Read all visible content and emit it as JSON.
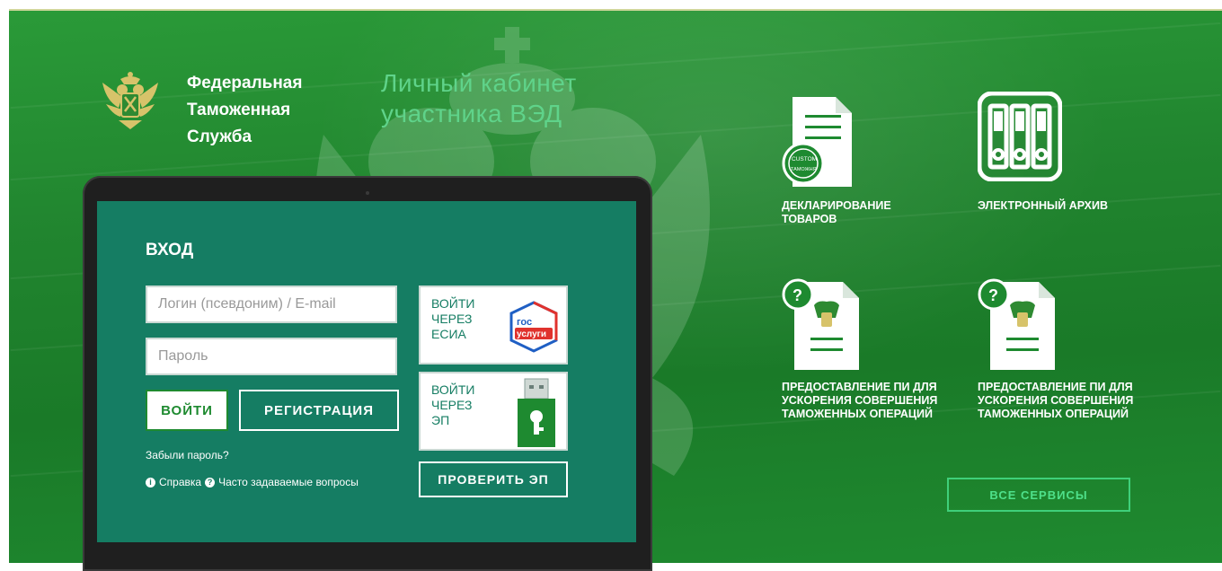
{
  "header": {
    "org_line1": "Федеральная",
    "org_line2": "Таможенная",
    "org_line3": "Служба",
    "app_line1": "Личный кабинет",
    "app_line2": "участника ВЭД"
  },
  "login": {
    "heading": "ВХОД",
    "login_placeholder": "Логин (псевдоним) / E-mail",
    "password_placeholder": "Пароль",
    "login_button": "ВОЙТИ",
    "register_button": "РЕГИСТРАЦИЯ",
    "forgot_password": "Забыли пароль?",
    "help_link": "Справка",
    "faq_link": "Часто задаваемые вопросы"
  },
  "alt_login": {
    "esia_line1": "ВОЙТИ",
    "esia_line2": "ЧЕРЕЗ",
    "esia_line3": "ЕСИА",
    "gosuslugi_top": "гос",
    "gosuslugi_bottom": "услуги",
    "ep_line1": "ВОЙТИ",
    "ep_line2": "ЧЕРЕЗ",
    "ep_line3": "ЭП",
    "check_ep_button": "ПРОВЕРИТЬ ЭП"
  },
  "services": {
    "item1_line1": "ДЕКЛАРИРОВАНИЕ",
    "item1_line2": "ТОВАРОВ",
    "item1_stamp_top": "CUSTOM",
    "item1_stamp_bottom": "ТАМОЖНЯ",
    "item2": "ЭЛЕКТРОННЫЙ АРХИВ",
    "item3_line1": "ПРЕДОСТАВЛЕНИЕ ПИ ДЛЯ",
    "item3_line2": "УСКОРЕНИЯ СОВЕРШЕНИЯ",
    "item3_line3": "ТАМОЖЕННЫХ ОПЕРАЦИЙ",
    "item4_line1": "ПРЕДОСТАВЛЕНИЕ ПИ ДЛЯ",
    "item4_line2": "УСКОРЕНИЯ СОВЕРШЕНИЯ",
    "item4_line3": "ТАМОЖЕННЫХ ОПЕРАЦИЙ",
    "all_services_button": "ВСЕ СЕРВИСЫ"
  },
  "colors": {
    "background": "#1f8a30",
    "screen": "#157d63",
    "accent_text": "#5fd38a",
    "button_outline": "#3fd07a"
  }
}
